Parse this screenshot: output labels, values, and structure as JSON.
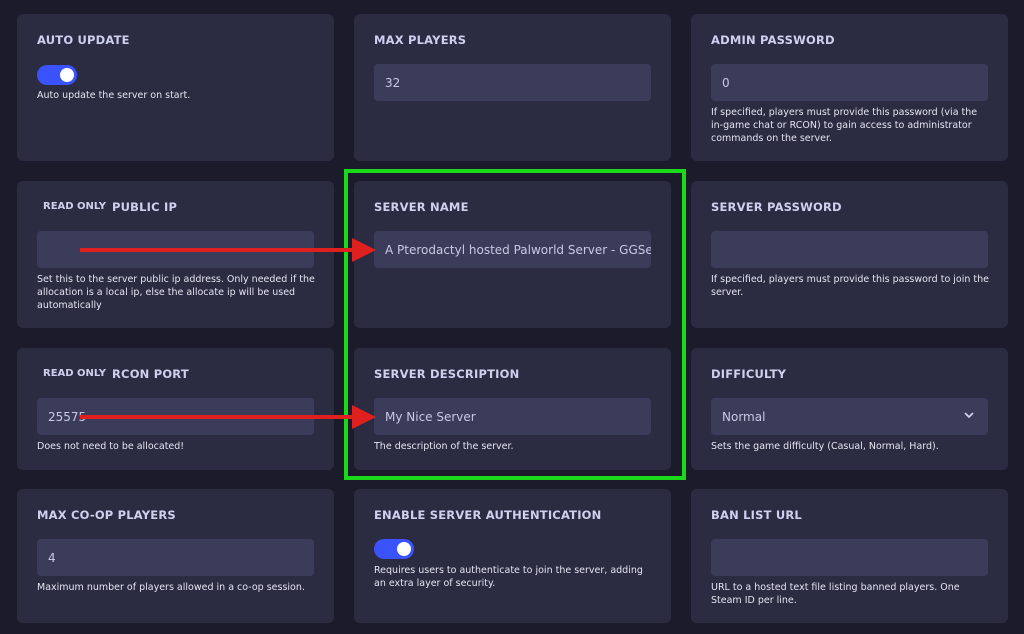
{
  "cards": {
    "auto_update": {
      "title": "AUTO UPDATE",
      "description": "Auto update the server on start.",
      "toggle_on": true
    },
    "max_players": {
      "title": "MAX PLAYERS",
      "value": "32"
    },
    "admin_password": {
      "title": "ADMIN PASSWORD",
      "value": "0",
      "description": "If specified, players must provide this password (via the in-game chat or RCON) to gain access to administrator commands on the server."
    },
    "public_ip": {
      "badge": "READ ONLY",
      "title": "PUBLIC IP",
      "value": "",
      "description": "Set this to the server public ip address. Only needed if the allocation is a local ip, else the allocate ip will be used automatically"
    },
    "server_name": {
      "title": "SERVER NAME",
      "value": "A Pterodactyl hosted Palworld Server - GGServers"
    },
    "server_password": {
      "title": "SERVER PASSWORD",
      "value": "",
      "description": "If specified, players must provide this password to join the server."
    },
    "rcon_port": {
      "badge": "READ ONLY",
      "title": "RCON PORT",
      "value": "25575",
      "description": "Does not need to be allocated!"
    },
    "server_description": {
      "title": "SERVER DESCRIPTION",
      "value": "My Nice Server",
      "description": "The description of the server."
    },
    "difficulty": {
      "title": "DIFFICULTY",
      "selected": "Normal",
      "description": "Sets the game difficulty (Casual, Normal, Hard)."
    },
    "max_coop_players": {
      "title": "MAX CO-OP PLAYERS",
      "value": "4",
      "description": "Maximum number of players allowed in a co-op session."
    },
    "server_authentication": {
      "title": "ENABLE SERVER AUTHENTICATION",
      "description": "Requires users to authenticate to join the server, adding an extra layer of security.",
      "toggle_on": true
    },
    "ban_list_url": {
      "title": "BAN LIST URL",
      "value": "",
      "description": "URL to a hosted text file listing banned players. One Steam ID per line."
    }
  },
  "colors": {
    "background": "#1b1b2c",
    "card": "#2b2c42",
    "input": "#3b3c59",
    "toggle": "#3b53ff",
    "highlight": "#1ad81a",
    "arrow": "#e01f1f"
  }
}
